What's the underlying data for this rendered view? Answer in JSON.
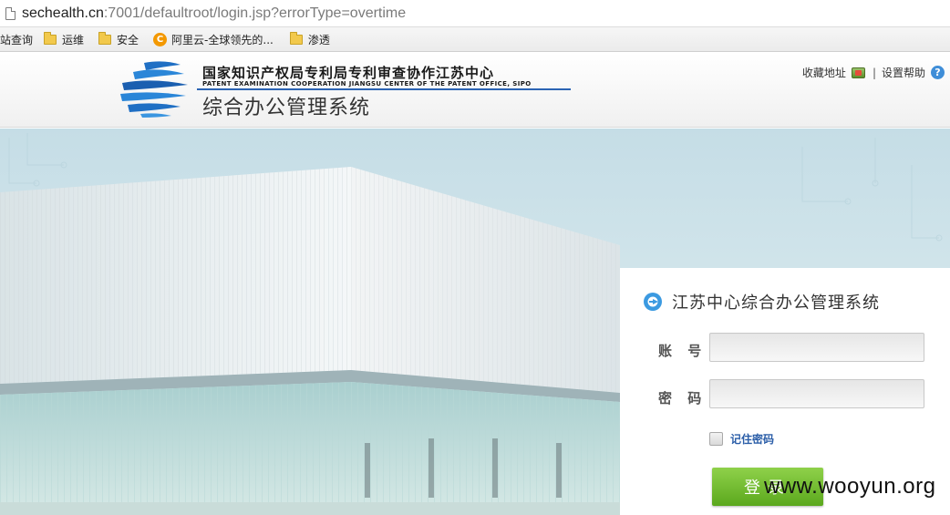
{
  "browser": {
    "url_host": "sechealth.cn",
    "url_rest": ":7001/defaultroot/login.jsp?errorType=overtime",
    "bookmarks": [
      {
        "label": "站查询",
        "icon": "none"
      },
      {
        "label": "运维",
        "icon": "folder-icon"
      },
      {
        "label": "安全",
        "icon": "folder-icon"
      },
      {
        "label": "阿里云-全球领先的...",
        "icon": "aliyun-icon"
      },
      {
        "label": "渗透",
        "icon": "folder-icon"
      }
    ]
  },
  "header": {
    "org_name_cn": "国家知识产权局专利局专利审查协作江苏中心",
    "org_name_en": "PATENT EXAMINATION COOPERATION JIANGSU CENTER OF THE PATENT OFFICE, SIPO",
    "system_title": "综合办公管理系统",
    "links": {
      "favorite": "收藏地址",
      "separator": "|",
      "help": "设置帮助"
    }
  },
  "login": {
    "title": "江苏中心综合办公管理系统",
    "account_label": "账 号",
    "account_value": "",
    "password_label": "密 码",
    "password_value": "",
    "remember_label": "记住密码",
    "remember_checked": false,
    "submit_label": "登录"
  },
  "watermark": "www.wooyun.org",
  "colors": {
    "accent_blue": "#2b63b3",
    "login_button": "#6fbe2d"
  }
}
